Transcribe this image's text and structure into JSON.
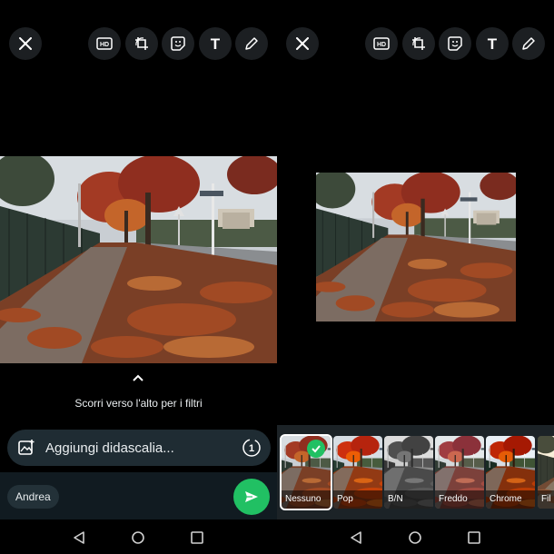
{
  "editor": {
    "hd_icon_label": "HD",
    "text_tool_label": "T"
  },
  "left_panel": {
    "swipe_hint": "Scorri verso l'alto per i filtri",
    "caption_placeholder": "Aggiungi didascalia...",
    "timer_label": "1",
    "recipient": "Andrea"
  },
  "right_panel": {
    "filters": [
      {
        "label": "Nessuno",
        "selected": true
      },
      {
        "label": "Pop",
        "selected": false
      },
      {
        "label": "B/N",
        "selected": false
      },
      {
        "label": "Freddo",
        "selected": false
      },
      {
        "label": "Chrome",
        "selected": false
      },
      {
        "label": "Fil",
        "selected": false
      }
    ]
  },
  "colors": {
    "background": "#000000",
    "button_bg": "#1c1f22",
    "caption_bg": "#1f2c33",
    "send_green": "#21c063",
    "filter_strip_bg": "#1c2327"
  },
  "icons": [
    "close-icon",
    "hd-icon",
    "crop-rotate-icon",
    "sticker-icon",
    "text-icon",
    "pencil-icon",
    "chevron-up-icon",
    "add-sticker-icon",
    "view-once-timer-icon",
    "send-icon",
    "back-nav-icon",
    "home-nav-icon",
    "recents-nav-icon",
    "check-icon"
  ]
}
